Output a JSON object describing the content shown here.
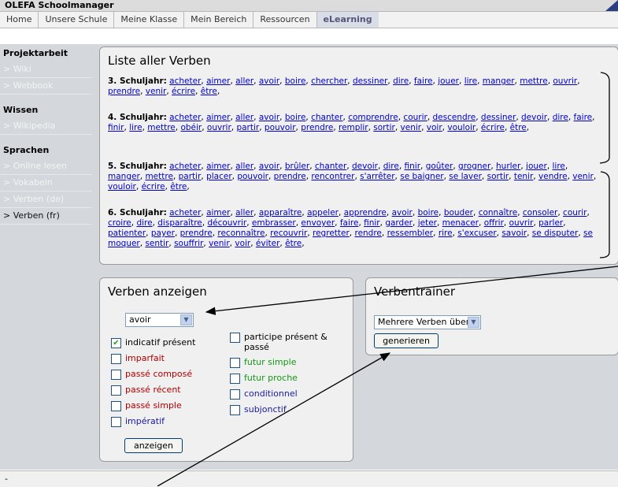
{
  "window": {
    "title": "OLEFA Schoolmanager"
  },
  "nav": {
    "tabs": [
      {
        "label": "Home"
      },
      {
        "label": "Unsere Schule"
      },
      {
        "label": "Meine Klasse"
      },
      {
        "label": "Mein Bereich"
      },
      {
        "label": "Ressourcen"
      },
      {
        "label": "eLearning",
        "active": true
      }
    ]
  },
  "sidebar": {
    "sections": [
      {
        "title": "Projektarbeit",
        "items": [
          "> Wiki",
          "> Webbook"
        ]
      },
      {
        "title": "Wissen",
        "items": [
          "> Wikipedia"
        ]
      },
      {
        "title": "Sprachen",
        "items": [
          "> Online lesen",
          "> Vokabeln",
          "> Verben (de)",
          "> Verben (fr)"
        ]
      }
    ],
    "active_item": "> Verben (fr)"
  },
  "verbs_panel": {
    "title": "Liste aller Verben",
    "groups": [
      {
        "label": "3. Schuljahr:",
        "verbs": [
          "acheter",
          "aimer",
          "aller",
          "avoir",
          "boire",
          "chercher",
          "dessiner",
          "dire",
          "faire",
          "jouer",
          "lire",
          "manger",
          "mettre",
          "ouvrir",
          "prendre",
          "venir",
          "écrire",
          "être"
        ]
      },
      {
        "label": "4. Schuljahr:",
        "verbs": [
          "acheter",
          "aimer",
          "aller",
          "avoir",
          "boire",
          "chanter",
          "comprendre",
          "courir",
          "descendre",
          "dessiner",
          "devoir",
          "dire",
          "faire",
          "finir",
          "lire",
          "mettre",
          "obéir",
          "ouvrir",
          "partir",
          "pouvoir",
          "prendre",
          "remplir",
          "sortir",
          "venir",
          "voir",
          "vouloir",
          "écrire",
          "être"
        ]
      },
      {
        "label": "5. Schuljahr:",
        "verbs": [
          "acheter",
          "aimer",
          "aller",
          "avoir",
          "brûler",
          "chanter",
          "devoir",
          "dire",
          "finir",
          "goûter",
          "grogner",
          "hurler",
          "jouer",
          "lire",
          "manger",
          "mettre",
          "partir",
          "placer",
          "pouvoir",
          "prendre",
          "rencontrer",
          "s'arrêter",
          "se baigner",
          "se laver",
          "sortir",
          "tenir",
          "vendre",
          "venir",
          "vouloir",
          "écrire",
          "être"
        ]
      },
      {
        "label": "6. Schuljahr:",
        "verbs": [
          "acheter",
          "aimer",
          "aller",
          "apparaître",
          "appeler",
          "apprendre",
          "avoir",
          "boire",
          "bouder",
          "connaître",
          "consoler",
          "courir",
          "croire",
          "dire",
          "disparaître",
          "découvrir",
          "embrasser",
          "envoyer",
          "faire",
          "finir",
          "garder",
          "jeter",
          "menacer",
          "offrir",
          "ouvrir",
          "parler",
          "patienter",
          "payer",
          "prendre",
          "reconnaître",
          "recouvrir",
          "regretter",
          "rendre",
          "ressembler",
          "rire",
          "s'excuser",
          "savoir",
          "se disputer",
          "se moquer",
          "sentir",
          "souffrir",
          "venir",
          "voir",
          "éviter",
          "être"
        ]
      }
    ]
  },
  "anzeigen_panel": {
    "title": "Verben anzeigen",
    "select_value": "avoir",
    "options_left": [
      {
        "label": "indicatif présent",
        "checked": true,
        "color": "#000000"
      },
      {
        "label": "imparfait",
        "checked": false,
        "color": "#b00000"
      },
      {
        "label": "passé composé",
        "checked": false,
        "color": "#b00000"
      },
      {
        "label": "passé récent",
        "checked": false,
        "color": "#b00000"
      },
      {
        "label": "passé simple",
        "checked": false,
        "color": "#b00000"
      },
      {
        "label": "impératif",
        "checked": false,
        "color": "#1a1aa0"
      }
    ],
    "options_right": [
      {
        "label": "participe présent & passé",
        "checked": false,
        "color": "#000000"
      },
      {
        "label": "futur simple",
        "checked": false,
        "color": "#119911"
      },
      {
        "label": "futur proche",
        "checked": false,
        "color": "#119911"
      },
      {
        "label": "conditionnel",
        "checked": false,
        "color": "#1a1aa0"
      },
      {
        "label": "subjonctif",
        "checked": false,
        "color": "#1a1aa0"
      }
    ],
    "button_label": "anzeigen"
  },
  "trainer_panel": {
    "title": "Verbentrainer",
    "select_value": "Mehrere Verben üben",
    "button_label": "generieren"
  },
  "status": {
    "text": "-"
  }
}
